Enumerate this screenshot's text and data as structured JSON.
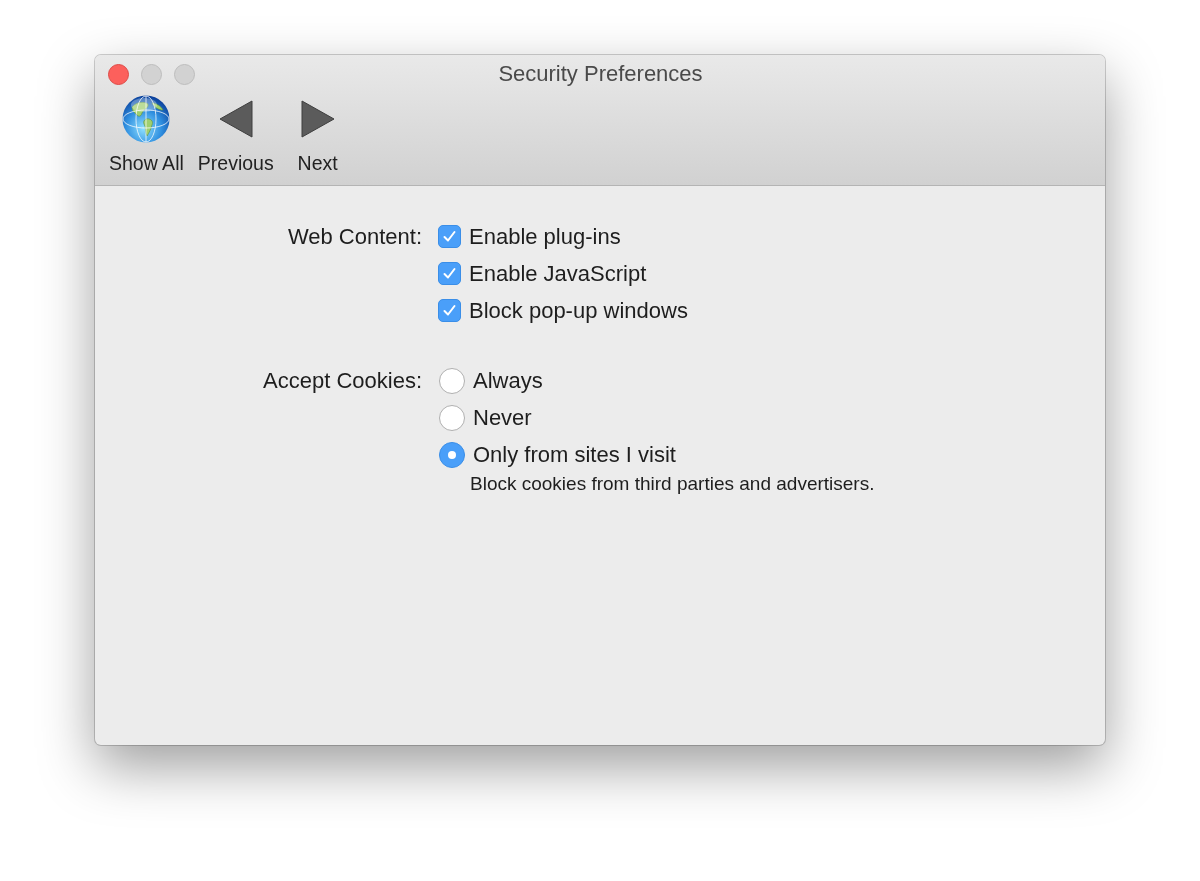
{
  "window": {
    "title": "Security Preferences",
    "buttons": [
      {
        "disabled": false
      },
      {
        "disabled": true
      },
      {
        "disabled": true
      }
    ]
  },
  "toolbar": {
    "items": [
      {
        "label": "Show All",
        "kind": "globe"
      },
      {
        "label": "Previous",
        "kind": "back"
      },
      {
        "label": "Next",
        "kind": "forward"
      }
    ]
  },
  "sections": [
    {
      "label": "Web Content:",
      "kind": "checkbox",
      "options": [
        {
          "label": "Enable plug-ins",
          "checked": true
        },
        {
          "label": "Enable JavaScript",
          "checked": true
        },
        {
          "label": "Block pop-up windows",
          "checked": true
        }
      ]
    },
    {
      "label": "Accept Cookies:",
      "kind": "radio",
      "options": [
        {
          "label": "Always",
          "selected": false
        },
        {
          "label": "Never",
          "selected": false
        },
        {
          "label": "Only from sites I visit",
          "selected": true,
          "note": "Block cookies from third parties and advertisers."
        }
      ]
    }
  ]
}
